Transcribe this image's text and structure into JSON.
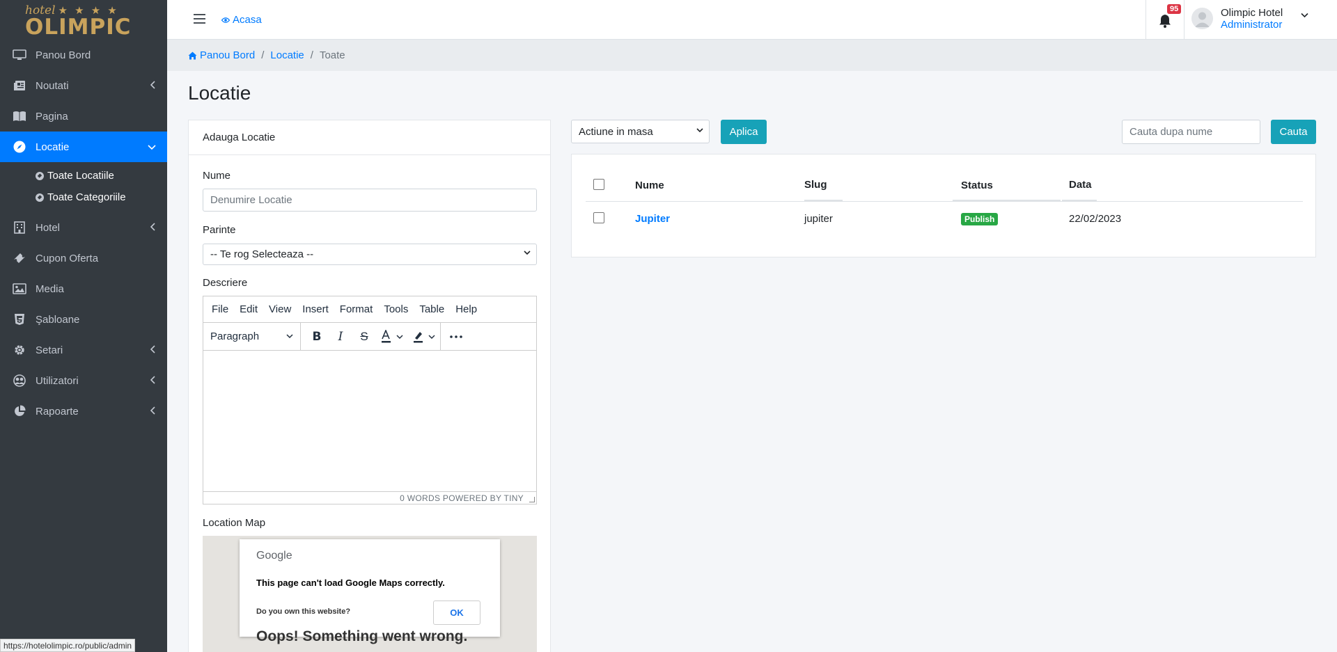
{
  "logo": {
    "word_hotel": "hotel",
    "stars": "★ ★ ★ ★",
    "word_name": "OLIMPIC"
  },
  "sidebar": {
    "items": [
      {
        "label": "Panou Bord",
        "icon": "monitor-icon"
      },
      {
        "label": "Noutati",
        "icon": "newspaper-icon"
      },
      {
        "label": "Pagina",
        "icon": "book-icon"
      },
      {
        "label": "Locatie",
        "icon": "compass-icon",
        "active": true
      },
      {
        "label": "Hotel",
        "icon": "building-icon"
      },
      {
        "label": "Cupon Oferta",
        "icon": "ticket-icon"
      },
      {
        "label": "Media",
        "icon": "image-icon"
      },
      {
        "label": "Şabloane",
        "icon": "html5-icon"
      },
      {
        "label": "Setari",
        "icon": "gear-icon"
      },
      {
        "label": "Utilizatori",
        "icon": "users-icon"
      },
      {
        "label": "Rapoarte",
        "icon": "pie-chart-icon"
      }
    ],
    "submenu": [
      {
        "label": "Toate Locatiile"
      },
      {
        "label": "Toate Categoriile"
      }
    ]
  },
  "status_url": "https://hotelolimpic.ro/public/admin",
  "header": {
    "home_link": "Acasa",
    "notification_count": "95",
    "user_name": "Olimpic Hotel",
    "user_role": "Administrator"
  },
  "breadcrumb": {
    "home": "Panou Bord",
    "section": "Locatie",
    "current": "Toate"
  },
  "page_title": "Locatie",
  "form": {
    "card_title": "Adauga Locatie",
    "name_label": "Nume",
    "name_placeholder": "Denumire Locatie",
    "parent_label": "Parinte",
    "parent_value": "-- Te rog Selecteaza --",
    "description_label": "Descriere",
    "editor_menu": [
      "File",
      "Edit",
      "View",
      "Insert",
      "Format",
      "Tools",
      "Table",
      "Help"
    ],
    "editor_block_format": "Paragraph",
    "editor_status": "0 WORDS  POWERED BY TINY",
    "map_label": "Location Map"
  },
  "map_error": {
    "brand": "Google",
    "message": "This page can't load Google Maps correctly.",
    "question": "Do you own this website?",
    "ok": "OK",
    "oops": "Oops! Something went wrong."
  },
  "list": {
    "bulk_action": "Actiune in masa",
    "apply_button": "Aplica",
    "search_placeholder": "Cauta dupa nume",
    "search_button": "Cauta",
    "columns": [
      "Nume",
      "Slug",
      "Status",
      "Data"
    ],
    "rows": [
      {
        "name": "Jupiter",
        "slug": "jupiter",
        "status": "Publish",
        "date": "22/02/2023"
      }
    ]
  },
  "colors": {
    "sidebar_bg": "#343a40",
    "active": "#007bff",
    "info": "#17a2b8",
    "success": "#28a745",
    "danger": "#dc3545"
  }
}
